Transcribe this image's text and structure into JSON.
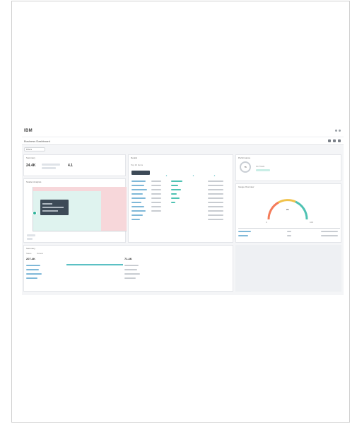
{
  "app": {
    "logo": "IBM",
    "dashboard_name": "Business Dashboard"
  },
  "filters": {
    "chip": "Filters"
  },
  "kpi": {
    "title": "Summary",
    "value_a": "24.4K",
    "value_b": "4.1"
  },
  "scatter": {
    "title": "Scatter Analysis",
    "x_axis_label": ""
  },
  "table": {
    "title": "Details",
    "subtitle": "Top 10 Items",
    "header_label": "Name"
  },
  "circle_panel": {
    "title": "Performance",
    "badge": "76",
    "status": "On Track"
  },
  "gauge": {
    "title": "Gauge Overview",
    "value_label": "72",
    "min": "0",
    "max": "100"
  },
  "bottom_left": {
    "title": "Summary",
    "tab_a": "Sales",
    "tab_b": "Orders",
    "metric_a": "207.4K",
    "metric_b": "71.4K"
  },
  "colors": {
    "accent_teal": "#2fb39a",
    "zone_red": "#f7d7da",
    "zone_green": "#dff3ef",
    "dark_header": "#3d4a57",
    "gauge_red": "#f47c5a",
    "gauge_yellow": "#f0c24a",
    "gauge_teal": "#4fc2b3"
  },
  "icons": [
    "menu-icon",
    "settings-icon",
    "user-icon",
    "share-icon",
    "fullscreen-icon",
    "download-icon"
  ]
}
